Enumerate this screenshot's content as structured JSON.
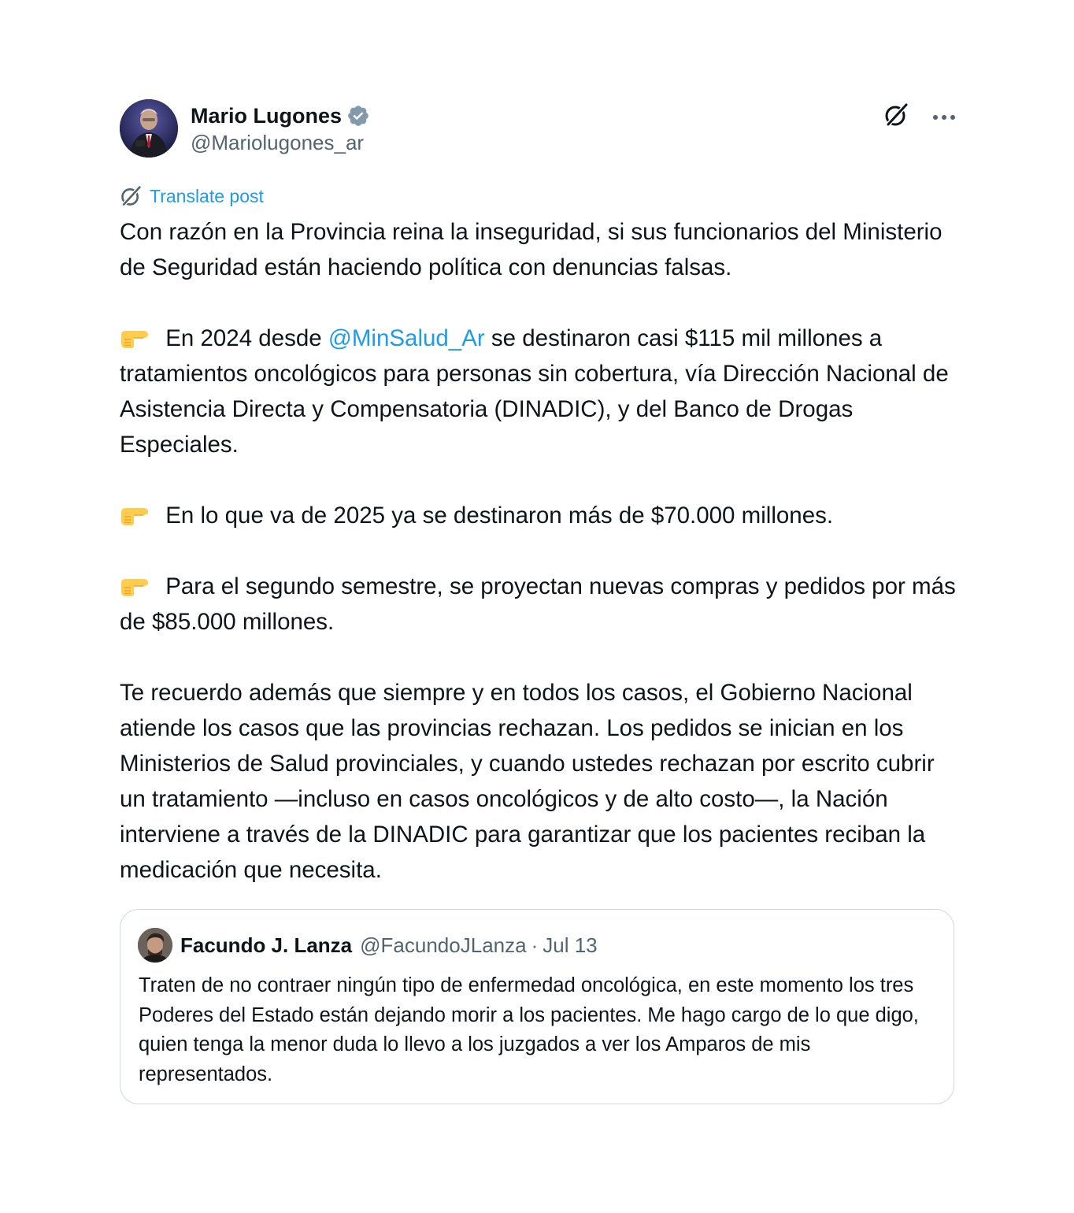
{
  "post": {
    "author": {
      "name": "Mario Lugones",
      "handle": "@Mariolugones_ar",
      "verified_badge_color": "#829aab"
    },
    "translate_label": "Translate post",
    "paragraphs": {
      "p1": "Con razón en la Provincia reina la inseguridad, si sus funcionarios del Ministerio de Seguridad están haciendo política con denuncias falsas.",
      "p2_before": " En 2024 desde ",
      "p2_mention": "@MinSalud_Ar",
      "p2_after": " se destinaron casi $115 mil millones a tratamientos oncológicos para personas sin cobertura, vía Dirección Nacional de Asistencia Directa y Compensatoria (DINADIC), y del Banco de Drogas Especiales.",
      "p3": " En lo que va de 2025 ya se destinaron más de $70.000 millones.",
      "p4": " Para el segundo semestre, se proyectan nuevas compras y pedidos por más de $85.000 millones.",
      "p5": "Te recuerdo además que siempre y en todos los casos, el Gobierno Nacional atiende los casos que las provincias rechazan. Los pedidos se inician en los Ministerios de Salud provinciales, y cuando ustedes rechazan por escrito cubrir un tratamiento —incluso en casos oncológicos y de alto costo—, la Nación interviene a través de la DINADIC para garantizar que los pacientes reciban la medicación que necesita."
    },
    "bullet_icon": "pointing-right-emoji",
    "link_color": "#1d9bf0"
  },
  "quoted_post": {
    "name": "Facundo J. Lanza",
    "handle": "@FacundoJLanza",
    "separator": "·",
    "date": "Jul 13",
    "text": "Traten de no contraer ningún tipo de enfermedad oncológica, en este momento los tres Poderes del Estado están dejando morir a los pacientes. Me hago cargo de lo que digo, quien tenga la menor duda lo llevo a los juzgados a ver los Amparos de mis representados."
  },
  "icons": {
    "grok": "grok-icon",
    "more": "more-icon",
    "translate": "translate-icon",
    "verified": "verified-badge-icon"
  }
}
